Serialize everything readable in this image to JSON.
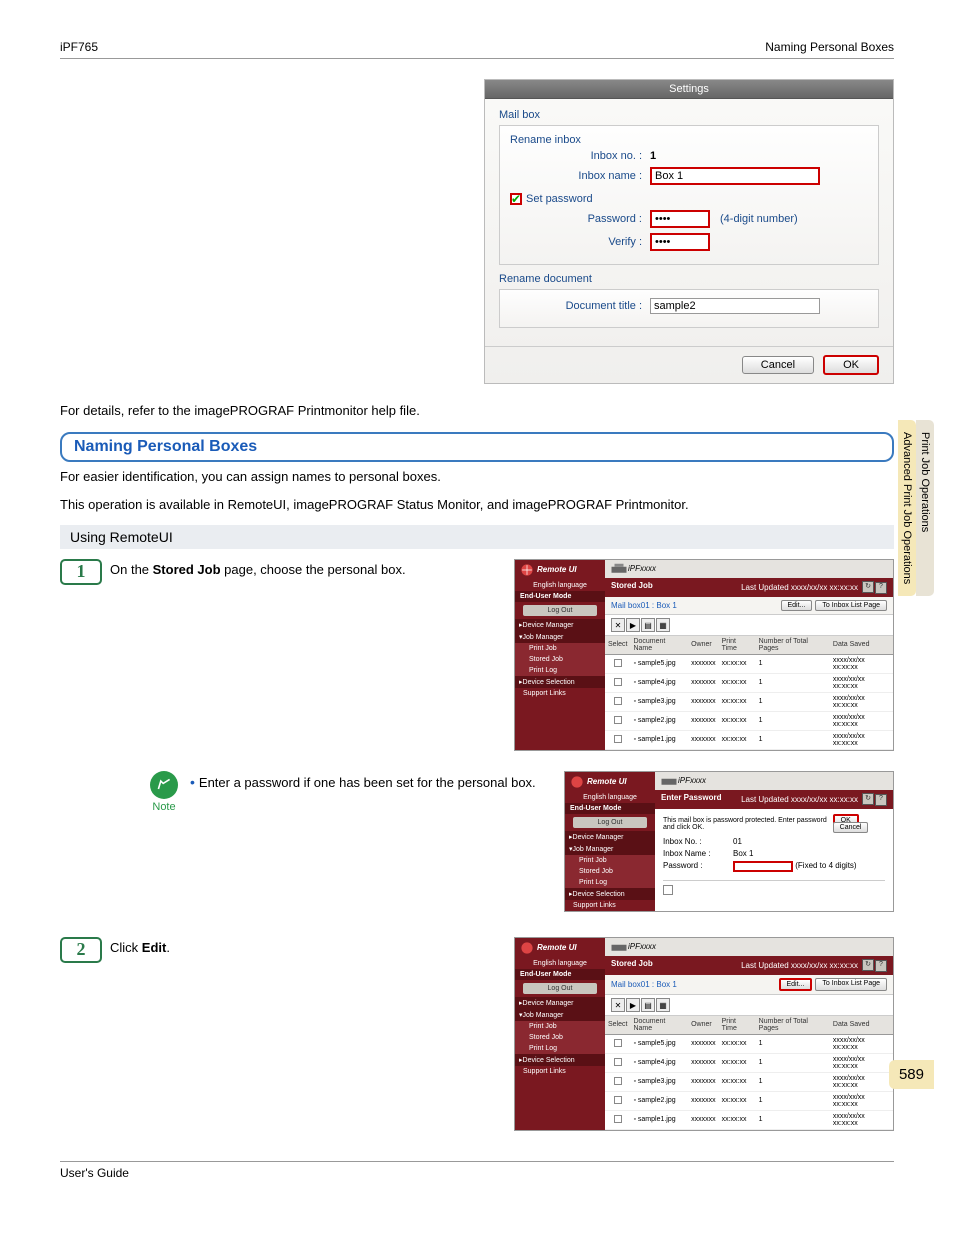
{
  "header": {
    "left": "iPF765",
    "right": "Naming Personal Boxes"
  },
  "settings": {
    "title": "Settings",
    "mailbox": "Mail box",
    "rename_inbox": "Rename inbox",
    "inbox_no_lbl": "Inbox no. :",
    "inbox_no_val": "1",
    "inbox_name_lbl": "Inbox name :",
    "inbox_name_val": "Box 1",
    "set_pw": "Set password",
    "pw_lbl": "Password :",
    "pw_val": "****",
    "pw_hint": "(4-digit number)",
    "verify_lbl": "Verify :",
    "verify_val": "****",
    "rename_doc": "Rename document",
    "doc_title_lbl": "Document title :",
    "doc_title_val": "sample2",
    "cancel": "Cancel",
    "ok": "OK"
  },
  "body": {
    "ref_text": "For details, refer to the imagePROGRAF Printmonitor help file.",
    "heading": "Naming Personal Boxes",
    "intro1": "For easier identification, you can assign names to personal boxes.",
    "intro2": "This operation is available in RemoteUI, imagePROGRAF Status Monitor, and imagePROGRAF Printmonitor.",
    "using": "Using RemoteUI",
    "step1_pre": "On the ",
    "step1_bold": "Stored Job",
    "step1_post": " page, choose the personal box.",
    "note_label": "Note",
    "note_text": "Enter a password if one has been set for the personal box.",
    "step2_pre": "Click ",
    "step2_bold": "Edit",
    "step2_post": "."
  },
  "remote": {
    "logo": "Remote UI",
    "lang": "English language",
    "mode": "End-User Mode",
    "logout": "Log Out",
    "nav_dm": "▸Device Manager",
    "nav_jm": "▾Job Manager",
    "nav_pj": "Print Job",
    "nav_sj": "Stored Job",
    "nav_pl": "Print Log",
    "nav_ds": "▸Device Selection",
    "nav_sl": "Support Links",
    "ipf": "iPFxxxx",
    "stored_job": "Stored Job",
    "updated": "Last Updated xxxx/xx/xx xx:xx:xx",
    "mailbox": "Mail box01 : Box 1",
    "edit_btn": "Edit...",
    "inbox_list": "To Inbox List Page",
    "cols": {
      "sel": "Select",
      "doc": "Document Name",
      "own": "Owner",
      "pt": "Print Time",
      "np": "Number of Total Pages",
      "ds": "Data Saved"
    },
    "rows": [
      {
        "d": "sample5.jpg",
        "o": "xxxxxxx",
        "t": "xx:xx:xx",
        "p": "1",
        "s": "xxxx/xx/xx xx:xx:xx"
      },
      {
        "d": "sample4.jpg",
        "o": "xxxxxxx",
        "t": "xx:xx:xx",
        "p": "1",
        "s": "xxxx/xx/xx xx:xx:xx"
      },
      {
        "d": "sample3.jpg",
        "o": "xxxxxxx",
        "t": "xx:xx:xx",
        "p": "1",
        "s": "xxxx/xx/xx xx:xx:xx"
      },
      {
        "d": "sample2.jpg",
        "o": "xxxxxxx",
        "t": "xx:xx:xx",
        "p": "1",
        "s": "xxxx/xx/xx xx:xx:xx"
      },
      {
        "d": "sample1.jpg",
        "o": "xxxxxxx",
        "t": "xx:xx:xx",
        "p": "1",
        "s": "xxxx/xx/xx xx:xx:xx"
      }
    ],
    "enter_pw": "Enter Password",
    "pw_msg": "This mail box is password protected. Enter password and click OK.",
    "ok": "OK",
    "cancel": "Cancel",
    "inbox_no_l": "Inbox No. :",
    "inbox_no_v": "01",
    "inbox_nm_l": "Inbox Name :",
    "inbox_nm_v": "Box 1",
    "pw_l": "Password :",
    "pw_hint": "(Fixed to 4 digits)"
  },
  "sidetabs": {
    "t1": "Print Job Operations",
    "t2": "Advanced Print Job Operations"
  },
  "page_num": "589",
  "footer": "User's Guide"
}
